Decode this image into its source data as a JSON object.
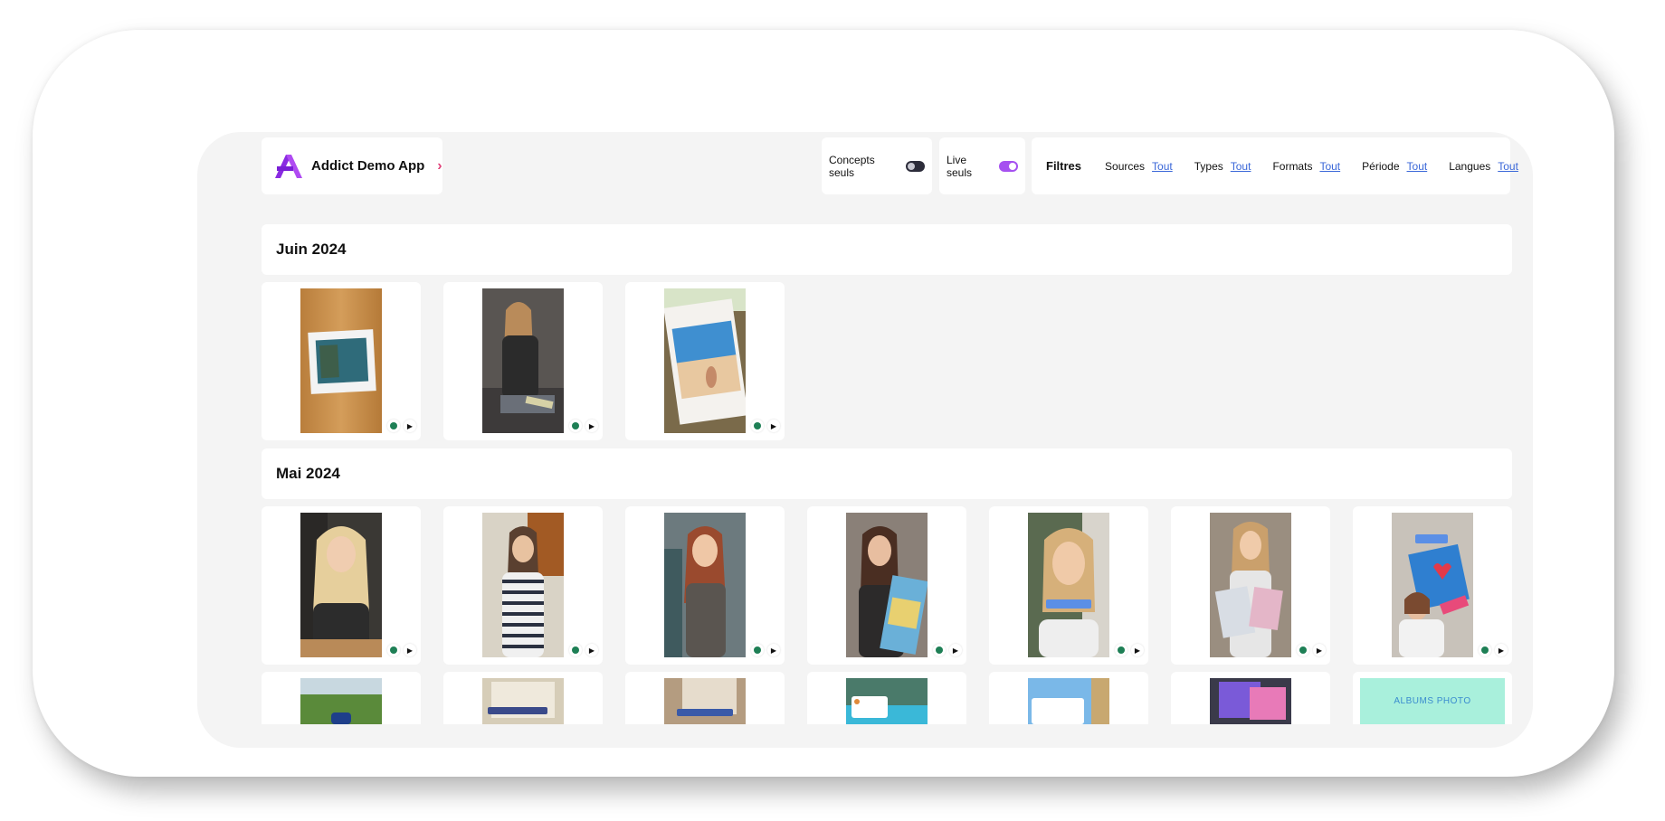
{
  "app": {
    "name": "Addict Demo App",
    "chevron": "›",
    "brand_color": "#a651f0"
  },
  "toggles": [
    {
      "label": "Concepts seuls",
      "state": "off"
    },
    {
      "label": "Live seuls",
      "state": "on"
    }
  ],
  "filters": {
    "title": "Filtres",
    "items": [
      {
        "label": "Sources",
        "value": "Tout"
      },
      {
        "label": "Types",
        "value": "Tout"
      },
      {
        "label": "Formats",
        "value": "Tout"
      },
      {
        "label": "Période",
        "value": "Tout"
      },
      {
        "label": "Langues",
        "value": "Tout"
      }
    ]
  },
  "sections": [
    {
      "title": "Juin 2024",
      "count_visible": 3
    },
    {
      "title": "Mai 2024",
      "count_visible": 14
    }
  ],
  "tile_extra": {
    "albums_label": "ALBUMS PHOTO"
  },
  "icons": {
    "status": "green-dot-icon",
    "play": "play-icon"
  }
}
